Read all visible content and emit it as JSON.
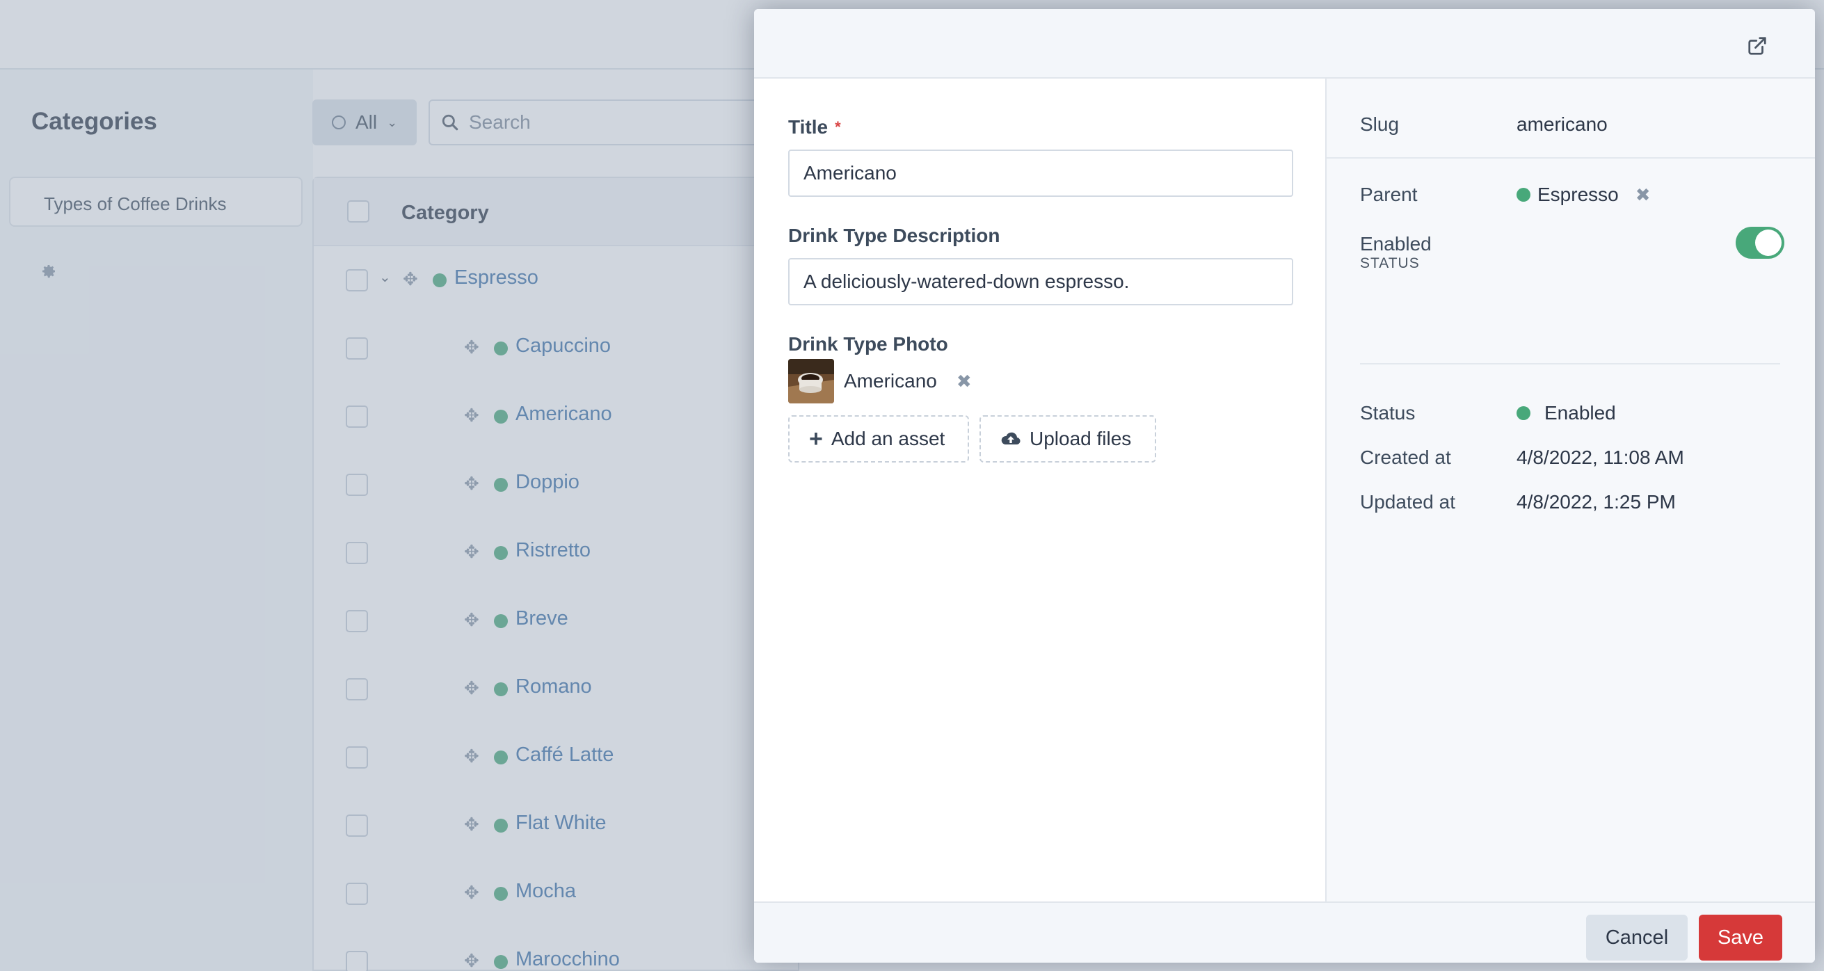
{
  "background": {
    "page_title": "Categories",
    "nav_item": "Types of Coffee Drinks",
    "filter_label": "All",
    "search_placeholder": "Search",
    "table_header": "Category",
    "rows": [
      {
        "name": "Espresso"
      },
      {
        "name": "Capuccino"
      },
      {
        "name": "Americano"
      },
      {
        "name": "Doppio"
      },
      {
        "name": "Ristretto"
      },
      {
        "name": "Breve"
      },
      {
        "name": "Romano"
      },
      {
        "name": "Caffé Latte"
      },
      {
        "name": "Flat White"
      },
      {
        "name": "Mocha"
      },
      {
        "name": "Marocchino"
      }
    ]
  },
  "modal": {
    "header_icon": "external-link-icon",
    "main": {
      "title_label": "Title",
      "required_mark": "*",
      "title_value": "Americano",
      "description_label": "Drink Type Description",
      "description_value": "A deliciously-watered-down espresso.",
      "photo_label": "Drink Type Photo",
      "photo_asset_name": "Americano",
      "add_asset_label": "Add an asset",
      "upload_label": "Upload files"
    },
    "sidebar": {
      "slug_label": "Slug",
      "slug_value": "americano",
      "parent_label": "Parent",
      "parent_value": "Espresso",
      "status_heading": "STATUS",
      "enabled_label": "Enabled",
      "enabled_on": true,
      "meta": {
        "status_label": "Status",
        "status_value": "Enabled",
        "created_label": "Created at",
        "created_value": "4/8/2022, 11:08 AM",
        "updated_label": "Updated at",
        "updated_value": "4/8/2022, 1:25 PM"
      }
    },
    "footer": {
      "cancel_label": "Cancel",
      "save_label": "Save"
    }
  },
  "colors": {
    "accent_green": "#48a87a",
    "save_red": "#d63939",
    "link_blue": "#3a6fa8"
  }
}
